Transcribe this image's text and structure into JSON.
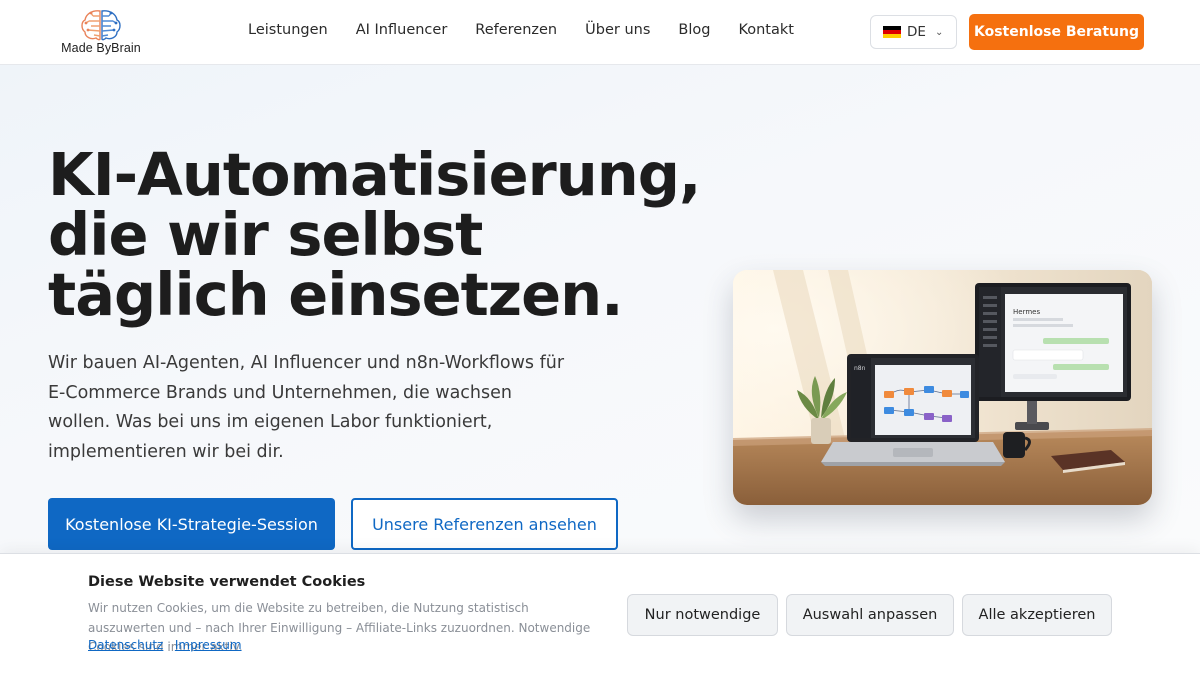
{
  "brand": {
    "name": "Made ByBrain"
  },
  "nav": {
    "items": [
      "Leistungen",
      "AI Influencer",
      "Referenzen",
      "Über uns",
      "Blog",
      "Kontakt"
    ]
  },
  "language": {
    "code": "DE",
    "flag_icon": "germany-flag-icon"
  },
  "header": {
    "cta_label": "Kostenlose Beratung",
    "cta_color": "#f5700f"
  },
  "hero": {
    "title_lines": [
      "KI-Automatisierung,",
      "die wir selbst",
      "täglich einsetzen."
    ],
    "subtitle": "Wir bauen AI-Agenten, AI Influencer und n8n-Workflows für E-Commerce Brands und Unternehmen, die wachsen wollen. Was bei uns im eigenen Labor funktioniert, implementieren wir bei dir.",
    "primary_button": "Kostenlose KI-Strategie-Session",
    "secondary_button": "Unsere Referenzen ansehen",
    "accent_color": "#0f68c4",
    "image": {
      "laptop_app_label": "n8n",
      "monitor_chat_title": "Hermes"
    }
  },
  "cookie": {
    "title": "Diese Website verwendet Cookies",
    "text": "Wir nutzen Cookies, um die Website zu betreiben, die Nutzung statistisch auszuwerten und – nach Ihrer Einwilligung – Affiliate-Links zuzuordnen. Notwendige Cookies sind immer aktiv.",
    "link_privacy": "Datenschutz",
    "separator": "·",
    "link_imprint": "Impressum",
    "buttons": {
      "necessary": "Nur notwendige",
      "customize": "Auswahl anpassen",
      "accept_all": "Alle akzeptieren"
    }
  }
}
